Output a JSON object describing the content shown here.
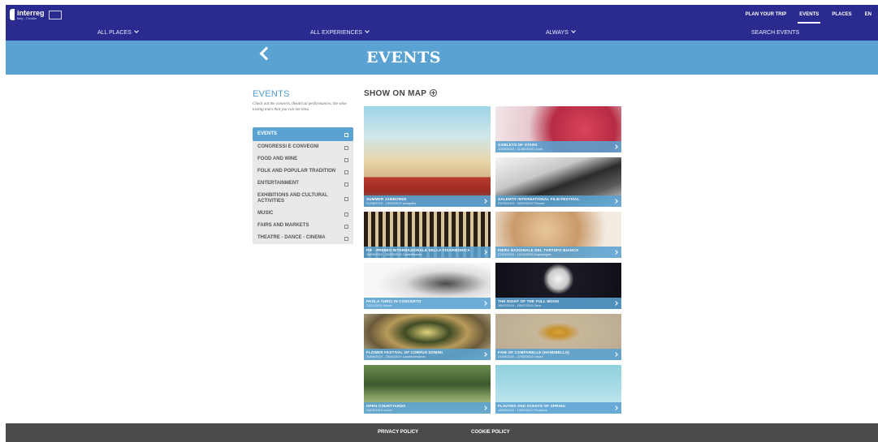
{
  "header": {
    "brand": "interreg",
    "brand_sub": "Italy - Croatia",
    "nav": [
      "PLAN YOUR TRIP",
      "EVENTS",
      "PLACES",
      "EN"
    ],
    "active_nav": "EVENTS"
  },
  "subnav": {
    "places": "ALL PLACES",
    "experiences": "ALL EXPERIENCES",
    "time": "ALWAYS",
    "search": "SEARCH EVENTS"
  },
  "banner": {
    "title": "EVENTS"
  },
  "sidebar": {
    "title": "EVENTS",
    "description": "Check out the concerts, theatrical performances, the wine tasting tours that you can not miss.",
    "filters": [
      {
        "label": "EVENTS",
        "active": true
      },
      {
        "label": "CONGRESSI E CONVEGNI",
        "active": false
      },
      {
        "label": "FOOD AND WINE",
        "active": false
      },
      {
        "label": "FOLK AND POPULAR TRADITION",
        "active": false
      },
      {
        "label": "ENTERTAINMENT",
        "active": false
      },
      {
        "label": "EXHIBITIONS AND CULTURAL ACTIVITIES",
        "active": false
      },
      {
        "label": "MUSIC",
        "active": false
      },
      {
        "label": "FAIRS AND MARKETS",
        "active": false
      },
      {
        "label": "THEATRE - DANCE - CINEMA",
        "active": false
      }
    ]
  },
  "main": {
    "map_button": "SHOW ON MAP",
    "events": [
      {
        "title": "SUMMER JAMBOREE",
        "dates": "01/08/2019 - 10/08/2019 senigallia"
      },
      {
        "title": "GOBLETS OF STARS",
        "dates": "10/08/2019 - 11/08/2019 Lecce"
      },
      {
        "title": "SALENTO INTERNATIONAL FILM FESTIVAL",
        "dates": "01/09/2019 - 08/09/2019 Tricase"
      },
      {
        "title": "PIF - PREMIO INTERNAZIONALE DELLA FISARMONICA",
        "dates": "18/09/2019 - 22/09/2019 Castelfidardo"
      },
      {
        "title": "FIERA NAZIONALE DEL TARTUFO BIANCO",
        "dates": "27/10/2019 - 10/11/2019 Acqualagna"
      },
      {
        "title": "PAOLA TURCI IN CONCERTO",
        "dates": "23/11/2019 Lecce"
      },
      {
        "title": "THE NIGHT OF THE FULL MOON",
        "dates": "18/07/2019 - 19/07/2019 Zara"
      },
      {
        "title": "FLOWER FESTIVAL OF CORPUS DOMINI",
        "dates": "20/06/2019 - 23/06/2019 Castelraimondo"
      },
      {
        "title": "FAIR OF CAMPARELLE (HANDBELLS)",
        "dates": "24/05/2019 - 27/05/2019 Lecce"
      },
      {
        "title": "OPEN COURTYARDS",
        "dates": "25/05/2019 Lecce"
      },
      {
        "title": "FLAVORS AND SCENTS OF SPRING",
        "dates": "18/05/2019 - 19/05/2019 Frontone"
      }
    ]
  },
  "footer": {
    "privacy": "PRIVACY POLICY",
    "cookie": "COOKIE POLICY"
  },
  "colors": {
    "nav_bg": "#2a2a8f",
    "accent": "#5aa2d2",
    "footer_bg": "#4b4b4b",
    "filter_bg": "#e9e9ea"
  }
}
